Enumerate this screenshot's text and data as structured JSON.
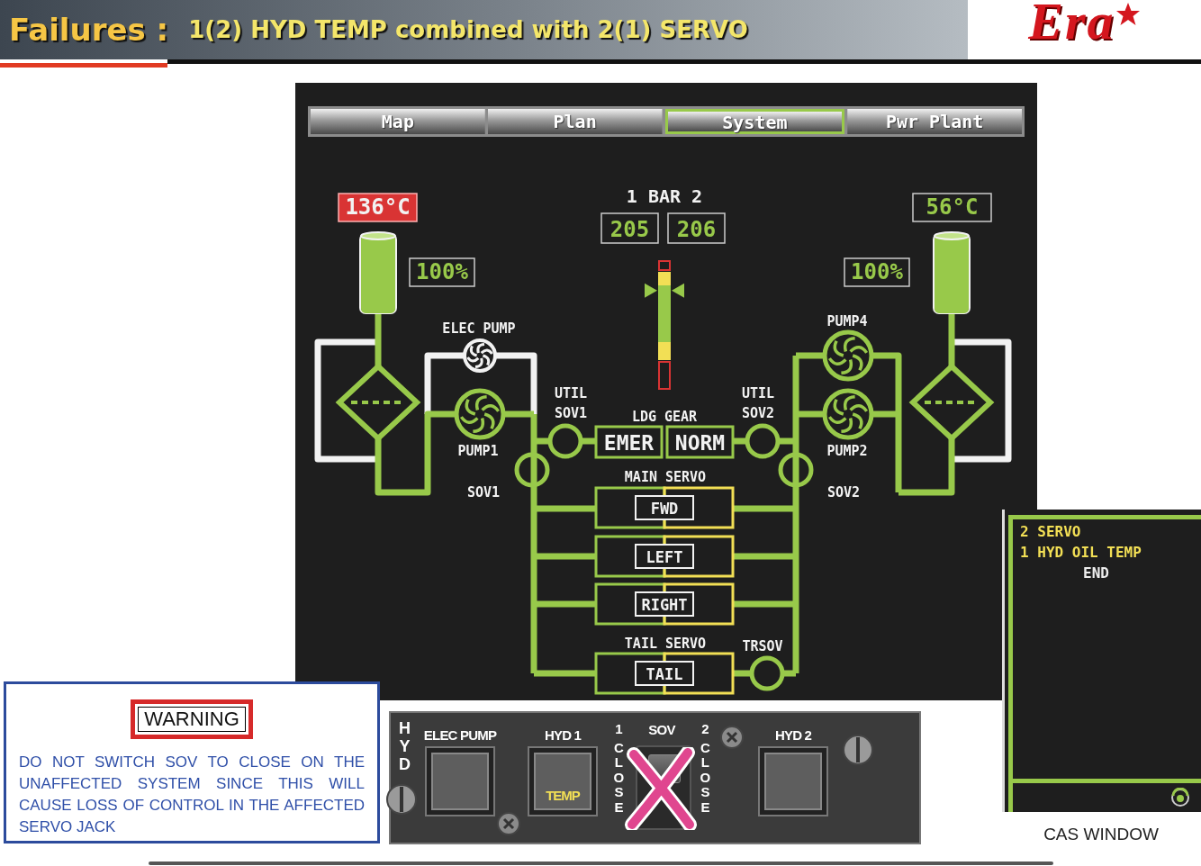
{
  "header": {
    "label": "Failures :",
    "title": "1(2) HYD TEMP combined with 2(1) SERVO",
    "logo": "Era"
  },
  "tabs": [
    {
      "label": "Map",
      "selected": false
    },
    {
      "label": "Plan",
      "selected": false
    },
    {
      "label": "System",
      "selected": true
    },
    {
      "label": "Pwr Plant",
      "selected": false
    }
  ],
  "system": {
    "temperatures": [
      {
        "text": "136°C",
        "alert": true
      },
      {
        "text": "56°C",
        "alert": false
      }
    ],
    "reservoirs": [
      {
        "text": "100%",
        "level": 1
      },
      {
        "text": "100%",
        "level": 1
      }
    ],
    "pressure": {
      "title": "1 BAR 2",
      "readings": [
        "205",
        "206"
      ],
      "level": 0.77
    },
    "pumps": [
      {
        "label": "ELEC PUMP",
        "on": false
      },
      {
        "label": "PUMP1",
        "on": true
      },
      {
        "label": "PUMP4",
        "on": true
      },
      {
        "label": "PUMP2",
        "on": true
      }
    ],
    "valves": [
      {
        "label": "UTIL SOV1"
      },
      {
        "label": "SOV1"
      },
      {
        "label": "UTIL SOV2"
      },
      {
        "label": "SOV2"
      },
      {
        "label": "TRSOV"
      }
    ],
    "landing_gear": {
      "title": "LDG GEAR",
      "modes": [
        "EMER",
        "NORM"
      ]
    },
    "servo_groups": [
      {
        "title": "MAIN SERVO",
        "servos": [
          "FWD",
          "LEFT",
          "RIGHT"
        ]
      },
      {
        "title": "TAIL SERVO",
        "servos": [
          "TAIL"
        ]
      }
    ],
    "servo_sides": [
      {
        "caution": false
      },
      {
        "caution": true
      }
    ]
  },
  "warning": {
    "title": "WARNING",
    "text": "DO NOT SWITCH SOV TO CLOSE ON THE UNAFFECTED SYSTEM SINCE THIS WILL CAUSE LOSS OF CONTROL IN THE AFFECTED SERVO JACK"
  },
  "panel": {
    "side_label": "HYD",
    "buttons": [
      {
        "label": "ELEC PUMP"
      },
      {
        "label": "HYD 1",
        "legend": "TEMP"
      },
      {
        "label": "HYD 2"
      }
    ],
    "sov_switch": {
      "label": "SOV",
      "crossed_out": true,
      "on": false,
      "positions": [
        {
          "number": "1",
          "text": "CLOSE"
        },
        {
          "number": "2",
          "text": "CLOSE"
        }
      ]
    }
  },
  "cas": {
    "messages": [
      {
        "text": "2 SERVO",
        "kind": "caution"
      },
      {
        "text": "1 HYD OIL TEMP",
        "kind": "caution"
      },
      {
        "text": "END",
        "kind": "end"
      }
    ],
    "caption": "CAS WINDOW"
  }
}
